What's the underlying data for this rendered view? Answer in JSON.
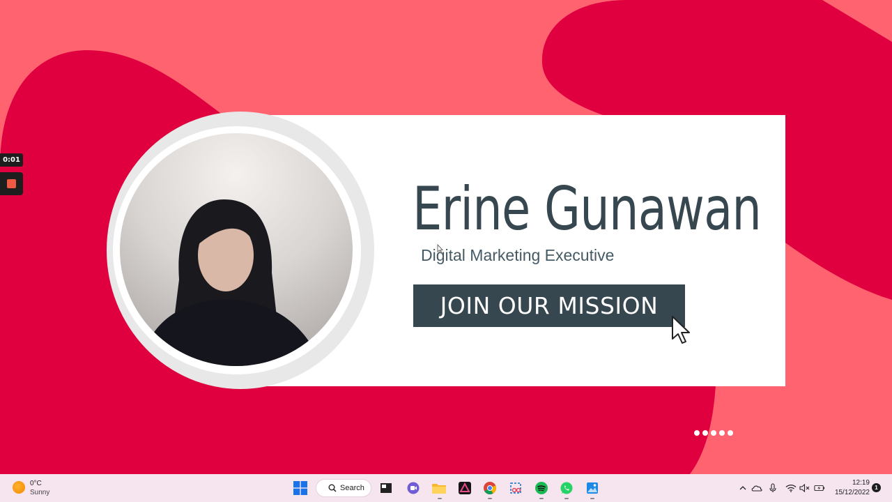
{
  "recording": {
    "timer": "0:01"
  },
  "profile": {
    "name": "Erine Gunawan",
    "role": "Digital Marketing Executive",
    "cta_label": "JOIN OUR MISSION"
  },
  "slide_dots": {
    "count": 5
  },
  "taskbar": {
    "weather": {
      "temp": "0°C",
      "condition": "Sunny",
      "icon": "sun-icon"
    },
    "search_label": "Search",
    "apps": [
      "windows-start-icon",
      "search-icon",
      "terminal-icon",
      "teams-icon",
      "file-explorer-icon",
      "affinity-icon",
      "chrome-icon",
      "snipping-tool-icon",
      "spotify-icon",
      "whatsapp-icon",
      "photos-icon"
    ],
    "tray": [
      "chevron-up-icon",
      "onedrive-icon",
      "microphone-icon",
      "wifi-icon",
      "volume-muted-icon",
      "battery-icon"
    ],
    "clock": {
      "time": "12:19",
      "date": "15/12/2022"
    },
    "notifications": "1"
  },
  "colors": {
    "background": "#ff6370",
    "blob": "#e0003f",
    "card": "#ffffff",
    "text_dark": "#37474f"
  }
}
